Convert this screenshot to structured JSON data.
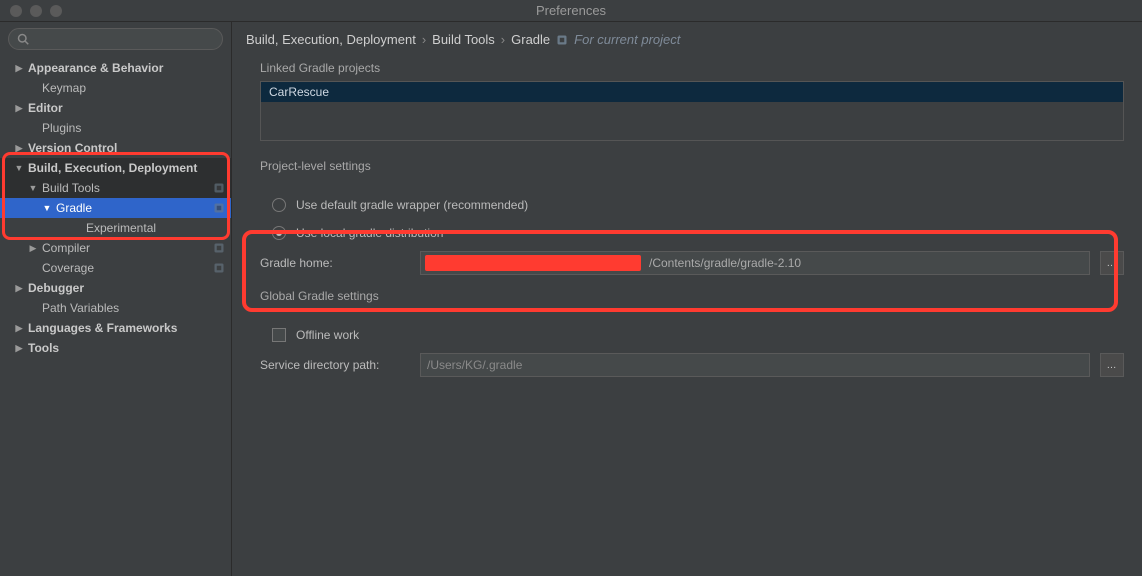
{
  "window": {
    "title": "Preferences"
  },
  "search": {
    "placeholder": ""
  },
  "sidebar": {
    "items": [
      {
        "label": "Appearance & Behavior",
        "depth": 0,
        "arrow": "right",
        "bold": true
      },
      {
        "label": "Keymap",
        "depth": 1
      },
      {
        "label": "Editor",
        "depth": 0,
        "arrow": "right",
        "bold": true
      },
      {
        "label": "Plugins",
        "depth": 1
      },
      {
        "label": "Version Control",
        "depth": 0,
        "arrow": "right",
        "bold": true
      },
      {
        "label": "Build, Execution, Deployment",
        "depth": 0,
        "arrow": "down",
        "bold": true,
        "ancestor": true
      },
      {
        "label": "Build Tools",
        "depth": 1,
        "arrow": "down",
        "ancestor": true,
        "badge": true
      },
      {
        "label": "Gradle",
        "depth": 2,
        "arrow": "down",
        "selected": true,
        "badge": true
      },
      {
        "label": "Experimental",
        "depth": 4
      },
      {
        "label": "Compiler",
        "depth": 1,
        "arrow": "right",
        "badge": true
      },
      {
        "label": "Coverage",
        "depth": 1,
        "badge": true
      },
      {
        "label": "Debugger",
        "depth": 0,
        "arrow": "right",
        "bold": true
      },
      {
        "label": "Path Variables",
        "depth": 1
      },
      {
        "label": "Languages & Frameworks",
        "depth": 0,
        "arrow": "right",
        "bold": true
      },
      {
        "label": "Tools",
        "depth": 0,
        "arrow": "right",
        "bold": true
      }
    ]
  },
  "breadcrumb": {
    "parts": [
      "Build, Execution, Deployment",
      "Build Tools",
      "Gradle"
    ],
    "scope": "For current project"
  },
  "linked": {
    "title": "Linked Gradle projects",
    "project": "CarRescue"
  },
  "project_settings": {
    "title": "Project-level settings",
    "radio_default": "Use default gradle wrapper (recommended)",
    "radio_local": "Use local gradle distribution",
    "selected": "local",
    "gradle_home_label": "Gradle home:",
    "gradle_home_value_suffix": "/Contents/gradle/gradle-2.10"
  },
  "global_settings": {
    "title": "Global Gradle settings",
    "offline_label": "Offline work",
    "svc_label": "Service directory path:",
    "svc_value": "/Users/KG/.gradle"
  },
  "browse_glyph": "…"
}
